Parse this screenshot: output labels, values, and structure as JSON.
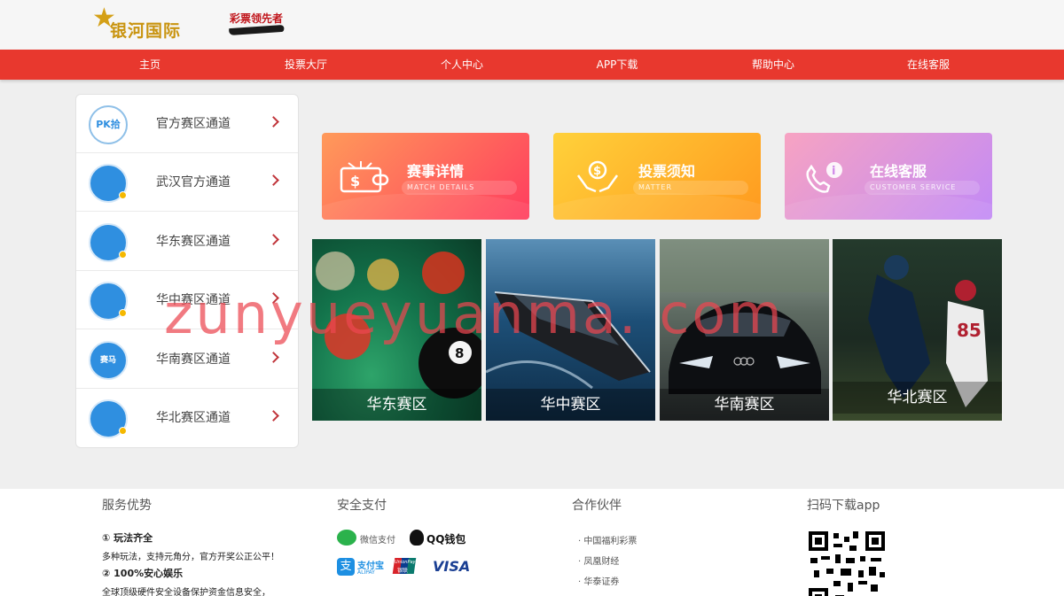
{
  "header": {
    "logo_text": "银河国际",
    "slogan": "彩票领先者"
  },
  "nav": [
    "主页",
    "投票大厅",
    "个人中心",
    "APP下载",
    "帮助中心",
    "在线客服"
  ],
  "channels": [
    {
      "label": "官方赛区通道",
      "icon": "pk10-logo-icon",
      "mark": "PK拾"
    },
    {
      "label": "武汉官方通道",
      "icon": "lottery-logo-icon",
      "mark": ""
    },
    {
      "label": "华东赛区通道",
      "icon": "lottery-logo-icon",
      "mark": ""
    },
    {
      "label": "华中赛区通道",
      "icon": "lottery-logo-icon",
      "mark": ""
    },
    {
      "label": "华南赛区通道",
      "icon": "horse-racing-logo-icon",
      "mark": "赛马"
    },
    {
      "label": "华北赛区通道",
      "icon": "lottery-logo-icon",
      "mark": ""
    }
  ],
  "cards": [
    {
      "title": "赛事详情",
      "subtitle": "MATCH DETAILS",
      "icon": "ticket-icon",
      "color_from": "#ff8a5a",
      "color_to": "#ff3d5e"
    },
    {
      "title": "投票须知",
      "subtitle": "MATTER",
      "icon": "money-hands-icon",
      "color_from": "#ffc93a",
      "color_to": "#ff9a1f"
    },
    {
      "title": "在线客服",
      "subtitle": "CUSTOMER SERVICE",
      "icon": "support-phone-icon",
      "color_from": "#f5a0c4",
      "color_to": "#c38af5"
    }
  ],
  "regions": [
    {
      "label": "华东赛区"
    },
    {
      "label": "华中赛区"
    },
    {
      "label": "华南赛区"
    },
    {
      "label": "华北赛区"
    }
  ],
  "watermark": "zunyueyuanma. com",
  "footer": {
    "service_title": "服务优势",
    "service_lines": [
      {
        "text": "① 玩法齐全",
        "bold": true
      },
      {
        "text": "多种玩法，支持元角分，官方开奖公正公平！",
        "bold": false
      },
      {
        "text": "② 100%安心娱乐",
        "bold": true
      },
      {
        "text": "全球顶级硬件安全设备保护资金信息安全，",
        "bold": false
      }
    ],
    "payment_title": "安全支付",
    "payments": [
      "微信支付",
      "QQ钱包",
      "支付宝",
      "银联",
      "VISA"
    ],
    "payment_sub": {
      "alipay": "ALIPAY",
      "unionpay": "UnionPay"
    },
    "partner_title": "合作伙伴",
    "partners": [
      "· 中国福利彩票",
      "· 凤凰财经",
      "· 华泰证券"
    ],
    "qr_title": "扫码下载app"
  },
  "colors": {
    "nav_bg": "#e8382e",
    "accent": "#c0343a",
    "logo_gold": "#c99410"
  }
}
